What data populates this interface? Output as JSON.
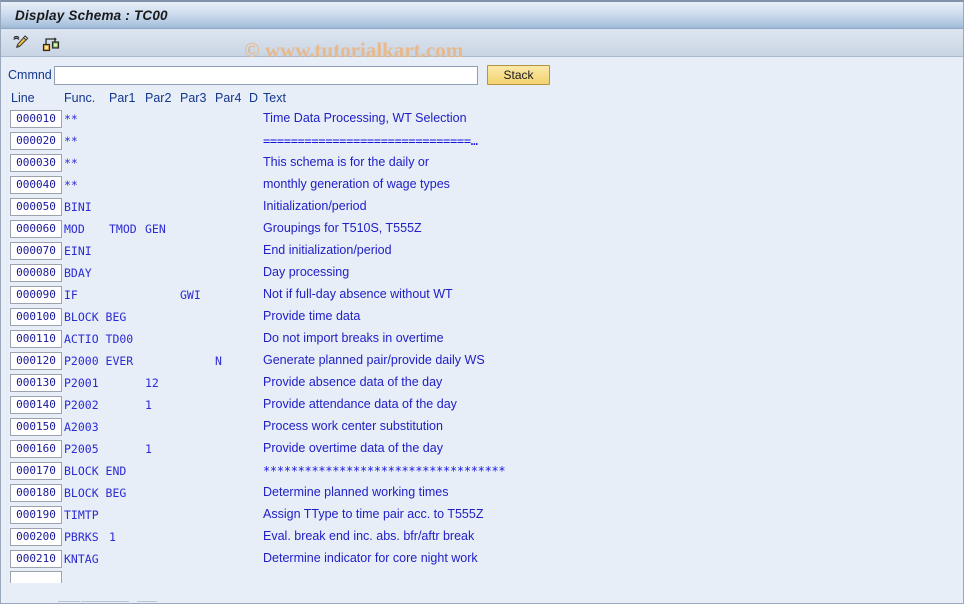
{
  "window": {
    "title": "Display Schema : TC00"
  },
  "toolbar": {
    "items": [
      {
        "name": "edit-pencil-icon",
        "tooltip": "Change"
      },
      {
        "name": "hierarchy-structure-icon",
        "tooltip": "Structure"
      }
    ]
  },
  "watermark": {
    "text": "© www.tutorialkart.com",
    "color": "#e7b98b"
  },
  "command": {
    "label": "Cmmnd",
    "value": "",
    "placeholder": "",
    "stack_label": "Stack"
  },
  "grid": {
    "headers": {
      "line": "Line",
      "func": "Func.",
      "par1": "Par1",
      "par2": "Par2",
      "par3": "Par3",
      "par4": "Par4",
      "d": "D",
      "text": "Text"
    },
    "rows": [
      {
        "line": "000010",
        "func": "**",
        "par1": "",
        "par2": "",
        "par3": "",
        "par4": "",
        "d": "",
        "text": "Time Data Processing, WT Selection",
        "symbolic": false
      },
      {
        "line": "000020",
        "func": "**",
        "par1": "",
        "par2": "",
        "par3": "",
        "par4": "",
        "d": "",
        "text": "==============================…",
        "symbolic": true
      },
      {
        "line": "000030",
        "func": "**",
        "par1": "",
        "par2": "",
        "par3": "",
        "par4": "",
        "d": "",
        "text": "This schema is for the daily or",
        "symbolic": false
      },
      {
        "line": "000040",
        "func": "**",
        "par1": "",
        "par2": "",
        "par3": "",
        "par4": "",
        "d": "",
        "text": "monthly generation of wage types",
        "symbolic": false
      },
      {
        "line": "000050",
        "func": "BINI",
        "par1": "",
        "par2": "",
        "par3": "",
        "par4": "",
        "d": "",
        "text": "Initialization/period",
        "symbolic": false
      },
      {
        "line": "000060",
        "func": "MOD",
        "par1": "TMOD",
        "par2": "GEN",
        "par3": "",
        "par4": "",
        "d": "",
        "text": "Groupings for T510S, T555Z",
        "symbolic": false
      },
      {
        "line": "000070",
        "func": "EINI",
        "par1": "",
        "par2": "",
        "par3": "",
        "par4": "",
        "d": "",
        "text": "End initialization/period",
        "symbolic": false
      },
      {
        "line": "000080",
        "func": "BDAY",
        "par1": "",
        "par2": "",
        "par3": "",
        "par4": "",
        "d": "",
        "text": "Day processing",
        "symbolic": false
      },
      {
        "line": "000090",
        "func": "IF",
        "par1": "",
        "par2": "",
        "par3": "GWI",
        "par4": "",
        "d": "",
        "text": "Not if full-day absence without WT",
        "symbolic": false
      },
      {
        "line": "000100",
        "func": "BLOCK BEG",
        "par1": "",
        "par2": "",
        "par3": "",
        "par4": "",
        "d": "",
        "text": "Provide time data",
        "symbolic": false
      },
      {
        "line": "000110",
        "func": "ACTIO TD00",
        "par1": "",
        "par2": "",
        "par3": "",
        "par4": "",
        "d": "",
        "text": "Do not import breaks in overtime",
        "symbolic": false
      },
      {
        "line": "000120",
        "func": "P2000 EVER",
        "par1": "",
        "par2": "",
        "par3": "",
        "par4": "N",
        "d": "",
        "text": "Generate planned pair/provide daily WS",
        "symbolic": false
      },
      {
        "line": "000130",
        "func": "P2001",
        "par1": "",
        "par2": "12",
        "par3": "",
        "par4": "",
        "d": "",
        "text": "Provide absence data of the day",
        "symbolic": false
      },
      {
        "line": "000140",
        "func": "P2002",
        "par1": "",
        "par2": "1",
        "par3": "",
        "par4": "",
        "d": "",
        "text": "Provide attendance data of the day",
        "symbolic": false
      },
      {
        "line": "000150",
        "func": "A2003",
        "par1": "",
        "par2": "",
        "par3": "",
        "par4": "",
        "d": "",
        "text": "Process work center substitution",
        "symbolic": false
      },
      {
        "line": "000160",
        "func": "P2005",
        "par1": "",
        "par2": "1",
        "par3": "",
        "par4": "",
        "d": "",
        "text": "Provide overtime data of the day",
        "symbolic": false
      },
      {
        "line": "000170",
        "func": "BLOCK END",
        "par1": "",
        "par2": "",
        "par3": "",
        "par4": "",
        "d": "",
        "text": "***********************************",
        "symbolic": true
      },
      {
        "line": "000180",
        "func": "BLOCK BEG",
        "par1": "",
        "par2": "",
        "par3": "",
        "par4": "",
        "d": "",
        "text": "Determine planned working times",
        "symbolic": false
      },
      {
        "line": "000190",
        "func": "TIMTP",
        "par1": "",
        "par2": "",
        "par3": "",
        "par4": "",
        "d": "",
        "text": "Assign TType to time pair acc. to T555Z",
        "symbolic": false
      },
      {
        "line": "000200",
        "func": "PBRKS",
        "par1": "1",
        "par2": "",
        "par3": "",
        "par4": "",
        "d": "",
        "text": "Eval. break end inc. abs. bfr/aftr break",
        "symbolic": false
      },
      {
        "line": "000210",
        "func": "KNTAG",
        "par1": "",
        "par2": "",
        "par3": "",
        "par4": "",
        "d": "",
        "text": "Determine indicator for core night work",
        "symbolic": false
      }
    ]
  }
}
